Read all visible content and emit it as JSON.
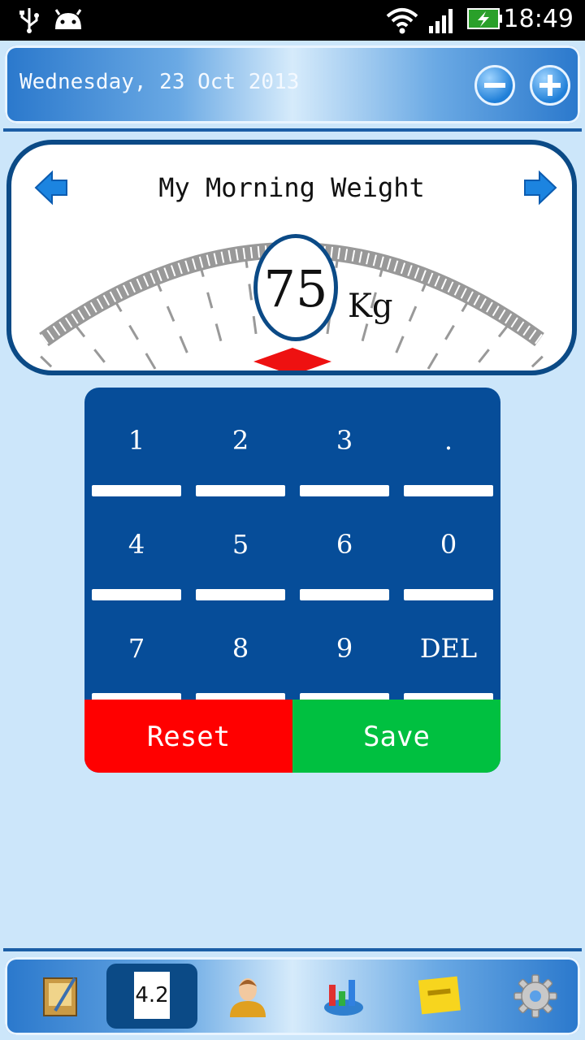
{
  "status_bar": {
    "time": "18:49"
  },
  "header": {
    "date": "Wednesday, 23 Oct 2013"
  },
  "gauge": {
    "title": "My Morning Weight",
    "value": "75",
    "unit": "Kg"
  },
  "keypad": {
    "keys": [
      "1",
      "2",
      "3",
      ".",
      "4",
      "5",
      "6",
      "0",
      "7",
      "8",
      "9",
      "DEL"
    ],
    "reset_label": "Reset",
    "save_label": "Save"
  },
  "bottom_nav": {
    "items": [
      {
        "icon": "journal-icon"
      },
      {
        "icon": "weight-record-icon",
        "label": "4.2"
      },
      {
        "icon": "profile-icon"
      },
      {
        "icon": "statistics-icon"
      },
      {
        "icon": "note-icon"
      },
      {
        "icon": "settings-gear-icon"
      }
    ],
    "active_index": 1
  },
  "colors": {
    "accent": "#0b4a86",
    "reset": "#ff0000",
    "save": "#00c040",
    "background": "#cce6fa"
  }
}
